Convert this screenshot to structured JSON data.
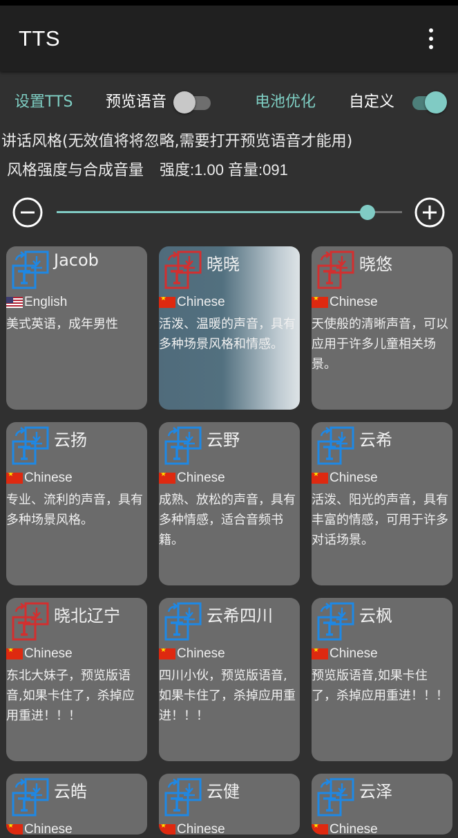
{
  "app": {
    "title": "TTS"
  },
  "controls": {
    "settings_label": "设置TTS",
    "preview_label": "预览语音",
    "preview_enabled": false,
    "battery_label": "电池优化",
    "custom_label": "自定义",
    "custom_enabled": true
  },
  "style_hint": "讲话风格(无效值将将忽略,需要打开预览语音才能用)",
  "intensity": {
    "label": "风格强度与合成音量",
    "value_text": "强度:1.00 音量:091",
    "level": 0.9
  },
  "colors": {
    "accent": "#80cbc4",
    "icon_blue": "#1e88e5",
    "icon_red": "#d32f2f",
    "card_bg": "#6b6b6b",
    "background": "#303030"
  },
  "voices": [
    {
      "name": "Jacob",
      "lang": "English",
      "flag": "us-flag-icon",
      "icon": "tts-voice-icon",
      "icon_color": "blue",
      "desc": "美式英语，成年男性",
      "selected": false
    },
    {
      "name": "晓晓",
      "lang": "Chinese",
      "flag": "cn-flag-icon",
      "icon": "tts-voice-icon",
      "icon_color": "red",
      "desc": "活泼、温暖的声音，具有多种场景风格和情感。",
      "selected": true
    },
    {
      "name": "晓悠",
      "lang": "Chinese",
      "flag": "cn-flag-icon",
      "icon": "tts-voice-icon",
      "icon_color": "red",
      "desc": "天使般的清晰声音，可以应用于许多儿童相关场景。",
      "selected": false
    },
    {
      "name": "云扬",
      "lang": "Chinese",
      "flag": "cn-flag-icon",
      "icon": "tts-voice-icon",
      "icon_color": "blue",
      "desc": "专业、流利的声音，具有多种场景风格。",
      "selected": false
    },
    {
      "name": "云野",
      "lang": "Chinese",
      "flag": "cn-flag-icon",
      "icon": "tts-voice-icon",
      "icon_color": "blue",
      "desc": "成熟、放松的声音，具有多种情感，适合音频书籍。",
      "selected": false
    },
    {
      "name": "云希",
      "lang": "Chinese",
      "flag": "cn-flag-icon",
      "icon": "tts-voice-icon",
      "icon_color": "blue",
      "desc": "活泼、阳光的声音，具有丰富的情感，可用于许多对话场景。",
      "selected": false
    },
    {
      "name": "晓北辽宁",
      "lang": "Chinese",
      "flag": "cn-flag-icon",
      "icon": "tts-voice-icon",
      "icon_color": "red",
      "desc": "东北大妹子，预览版语音,如果卡住了，杀掉应用重进！！！",
      "selected": false
    },
    {
      "name": "云希四川",
      "lang": "Chinese",
      "flag": "cn-flag-icon",
      "icon": "tts-voice-icon",
      "icon_color": "blue",
      "desc": "四川小伙，预览版语音,如果卡住了，杀掉应用重进！！！",
      "selected": false
    },
    {
      "name": "云枫",
      "lang": "Chinese",
      "flag": "cn-flag-icon",
      "icon": "tts-voice-icon",
      "icon_color": "blue",
      "desc": "预览版语音,如果卡住了，杀掉应用重进！！！",
      "selected": false
    },
    {
      "name": "云皓",
      "lang": "Chinese",
      "flag": "cn-flag-icon",
      "icon": "tts-voice-icon",
      "icon_color": "blue",
      "desc": "",
      "selected": false
    },
    {
      "name": "云健",
      "lang": "Chinese",
      "flag": "cn-flag-icon",
      "icon": "tts-voice-icon",
      "icon_color": "blue",
      "desc": "",
      "selected": false
    },
    {
      "name": "云泽",
      "lang": "Chinese",
      "flag": "cn-flag-icon",
      "icon": "tts-voice-icon",
      "icon_color": "blue",
      "desc": "",
      "selected": false
    }
  ]
}
